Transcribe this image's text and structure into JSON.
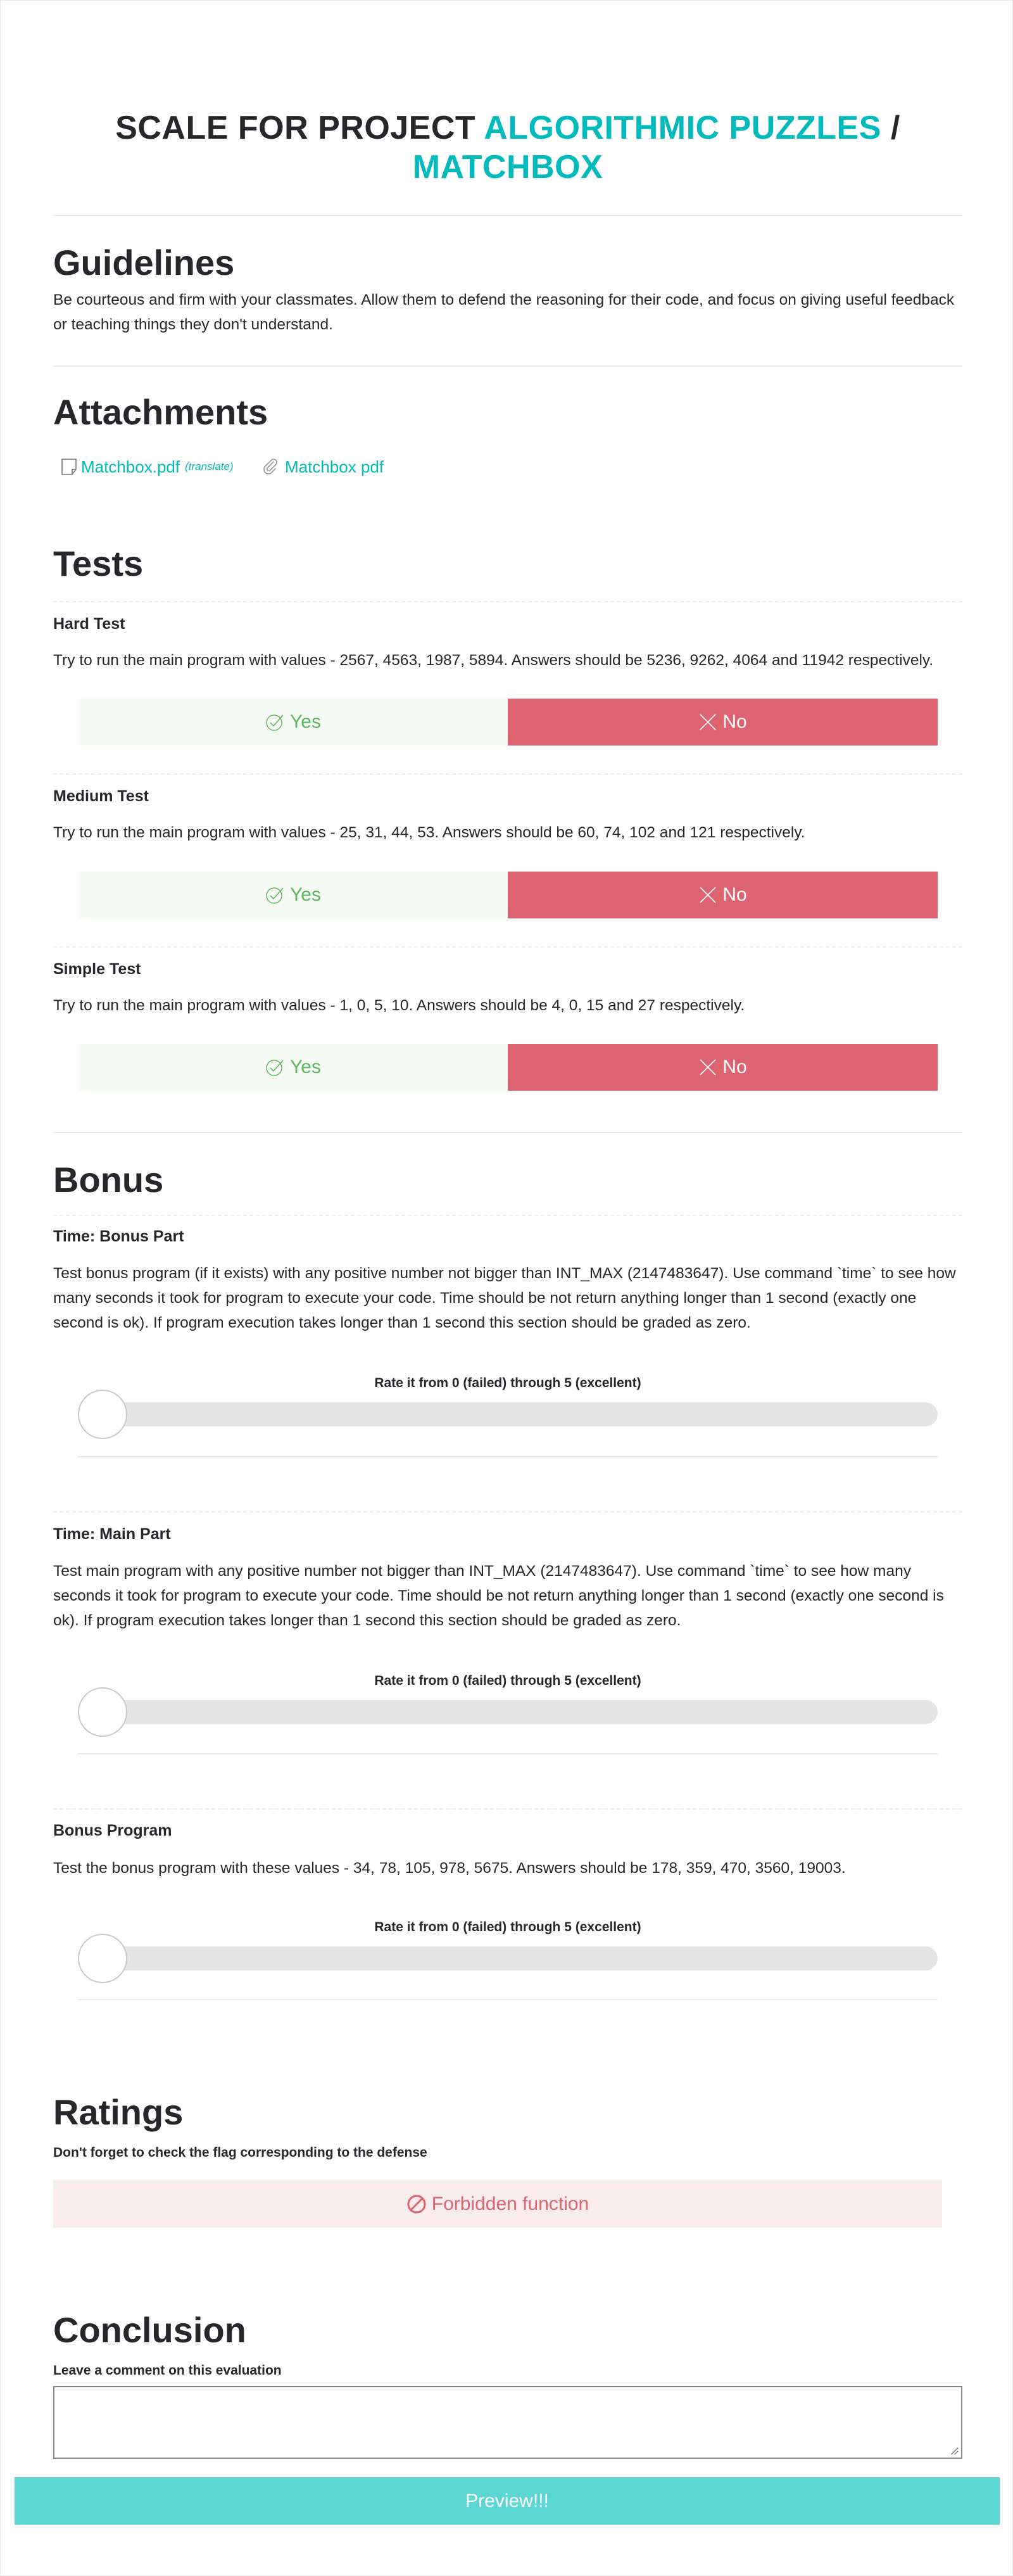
{
  "title": {
    "prefix": "SCALE FOR PROJECT",
    "project_line1": "ALGORITHMIC PUZZLES",
    "separator": "/",
    "project_line2": "MATCHBOX"
  },
  "guidelines": {
    "heading": "Guidelines",
    "text": "Be courteous and firm with your classmates. Allow them to defend the reasoning for their code, and focus on giving useful feedback or teaching things they don't understand."
  },
  "attachments": {
    "heading": "Attachments",
    "items": [
      {
        "label": "Matchbox.pdf",
        "extra": "(translate)",
        "icon": "document-icon"
      },
      {
        "label": "Matchbox pdf",
        "icon": "paperclip-icon"
      }
    ]
  },
  "tests": {
    "heading": "Tests",
    "items": [
      {
        "title": "Hard Test",
        "text": "Try to run the main program with values - 2567, 4563, 1987, 5894. Answers should be 5236, 9262, 4064 and 11942 respectively.",
        "yes": "Yes",
        "no": "No"
      },
      {
        "title": "Medium Test",
        "text": "Try to run the main program with values - 25, 31, 44, 53. Answers should be 60, 74, 102 and 121 respectively.",
        "yes": "Yes",
        "no": "No"
      },
      {
        "title": "Simple Test",
        "text": "Try to run the main program with values - 1, 0, 5, 10. Answers should be 4, 0, 15 and 27 respectively.",
        "yes": "Yes",
        "no": "No"
      }
    ]
  },
  "bonus": {
    "heading": "Bonus",
    "items": [
      {
        "title": "Time: Bonus Part",
        "text": "Test bonus program (if it exists) with any positive number not bigger than INT_MAX (2147483647). Use command `time` to see how many seconds it took for program to execute your code. Time should be not return anything longer than 1 second (exactly one second is ok). If program execution takes longer than 1 second this section should be graded as zero.",
        "rate_label": "Rate it from 0 (failed) through 5 (excellent)",
        "rating": 0
      },
      {
        "title": "Time: Main Part",
        "text": "Test main program with any positive number not bigger than INT_MAX (2147483647). Use command `time` to see how many seconds it took for program to execute your code. Time should be not return anything longer than 1 second (exactly one second is ok). If program execution takes longer than 1 second this section should be graded as zero.",
        "rate_label": "Rate it from 0 (failed) through 5 (excellent)",
        "rating": 0
      },
      {
        "title": "Bonus Program",
        "text": "Test the bonus program with these values - 34, 78, 105, 978, 5675. Answers should be 178, 359, 470, 3560, 19003.",
        "rate_label": "Rate it from 0 (failed) through 5 (excellent)",
        "rating": 0
      }
    ]
  },
  "ratings": {
    "heading": "Ratings",
    "subtitle": "Don't forget to check the flag corresponding to the defense",
    "flag_label": "Forbidden function",
    "flag_icon": "forbidden-icon"
  },
  "conclusion": {
    "heading": "Conclusion",
    "subtitle": "Leave a comment on this evaluation",
    "comment_value": "",
    "submit_label": "Preview!!!"
  },
  "colors": {
    "accent": "#00babc",
    "no_red": "#dc6370",
    "yes_green": "#5cb85c",
    "submit": "#5bd6d5"
  }
}
